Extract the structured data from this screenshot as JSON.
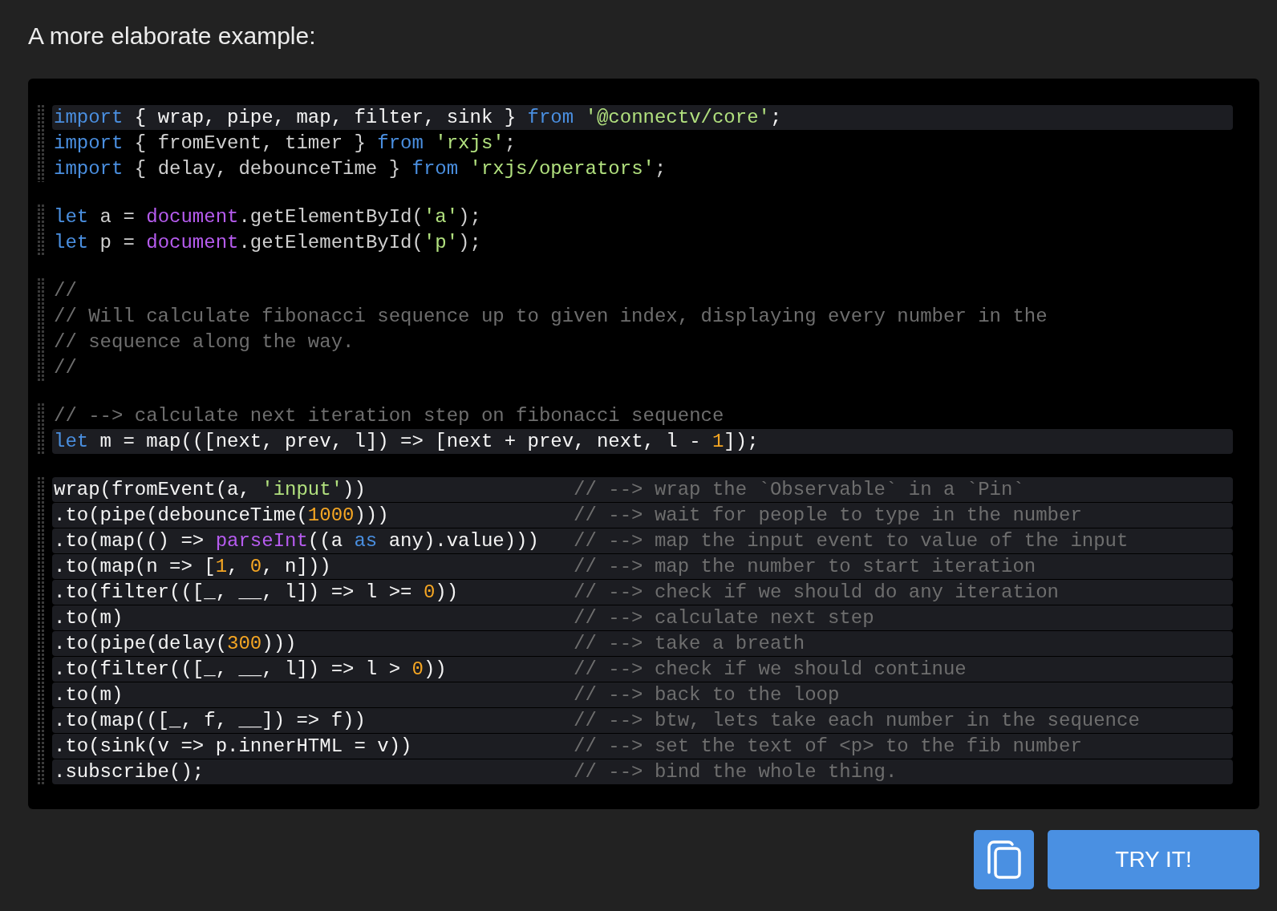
{
  "heading": "A more elaborate example:",
  "code_block": {
    "groups": [
      {
        "lines": [
          {
            "highlighted": true,
            "tokens": [
              {
                "kind": "keyword",
                "text": "import"
              },
              {
                "kind": "plain",
                "text": " { wrap, pipe, map, filter, sink } "
              },
              {
                "kind": "keyword",
                "text": "from"
              },
              {
                "kind": "string",
                "text": " '@connectv/core'"
              },
              {
                "kind": "plain",
                "text": ";"
              }
            ]
          },
          {
            "highlighted": false,
            "tokens": [
              {
                "kind": "keyword",
                "text": "import"
              },
              {
                "kind": "plain",
                "text": " { fromEvent, timer } "
              },
              {
                "kind": "keyword",
                "text": "from"
              },
              {
                "kind": "string",
                "text": " 'rxjs'"
              },
              {
                "kind": "plain",
                "text": ";"
              }
            ]
          },
          {
            "highlighted": false,
            "tokens": [
              {
                "kind": "keyword",
                "text": "import"
              },
              {
                "kind": "plain",
                "text": " { delay, debounceTime } "
              },
              {
                "kind": "keyword",
                "text": "from"
              },
              {
                "kind": "string",
                "text": " 'rxjs/operators'"
              },
              {
                "kind": "plain",
                "text": ";"
              }
            ]
          }
        ]
      },
      {
        "lines": [
          {
            "highlighted": false,
            "tokens": [
              {
                "kind": "keyword",
                "text": "let"
              },
              {
                "kind": "plain",
                "text": " a = "
              },
              {
                "kind": "builtin",
                "text": "document"
              },
              {
                "kind": "plain",
                "text": ".getElementById("
              },
              {
                "kind": "string",
                "text": "'a'"
              },
              {
                "kind": "plain",
                "text": ");"
              }
            ]
          },
          {
            "highlighted": false,
            "tokens": [
              {
                "kind": "keyword",
                "text": "let"
              },
              {
                "kind": "plain",
                "text": " p = "
              },
              {
                "kind": "builtin",
                "text": "document"
              },
              {
                "kind": "plain",
                "text": ".getElementById("
              },
              {
                "kind": "string",
                "text": "'p'"
              },
              {
                "kind": "plain",
                "text": ");"
              }
            ]
          }
        ]
      },
      {
        "lines": [
          {
            "highlighted": false,
            "tokens": [
              {
                "kind": "comment",
                "text": "//"
              }
            ]
          },
          {
            "highlighted": false,
            "tokens": [
              {
                "kind": "comment",
                "text": "// Will calculate fibonacci sequence up to given index, displaying every number in the"
              }
            ]
          },
          {
            "highlighted": false,
            "tokens": [
              {
                "kind": "comment",
                "text": "// sequence along the way."
              }
            ]
          },
          {
            "highlighted": false,
            "tokens": [
              {
                "kind": "comment",
                "text": "//"
              }
            ]
          }
        ]
      },
      {
        "lines": [
          {
            "highlighted": false,
            "tokens": [
              {
                "kind": "comment",
                "text": "// --> calculate next iteration step on fibonacci sequence"
              }
            ]
          },
          {
            "highlighted": true,
            "tokens": [
              {
                "kind": "keyword",
                "text": "let"
              },
              {
                "kind": "plain",
                "text": " m = map(([next, prev, l]) => [next + prev, next, l - "
              },
              {
                "kind": "number",
                "text": "1"
              },
              {
                "kind": "plain",
                "text": "]);"
              }
            ]
          }
        ]
      },
      {
        "lines": [
          {
            "highlighted": true,
            "tokens": [
              {
                "kind": "plain",
                "text": "wrap(fromEvent(a, "
              },
              {
                "kind": "string",
                "text": "'input'"
              },
              {
                "kind": "plain",
                "text": "))"
              }
            ],
            "comment": "// --> wrap the `Observable` in a `Pin`"
          },
          {
            "highlighted": true,
            "tokens": [
              {
                "kind": "plain",
                "text": ".to(pipe(debounceTime("
              },
              {
                "kind": "number",
                "text": "1000"
              },
              {
                "kind": "plain",
                "text": ")))"
              }
            ],
            "comment": "// --> wait for people to type in the number"
          },
          {
            "highlighted": true,
            "tokens": [
              {
                "kind": "plain",
                "text": ".to(map(() => "
              },
              {
                "kind": "builtin",
                "text": "parseInt"
              },
              {
                "kind": "plain",
                "text": "((a "
              },
              {
                "kind": "keyword",
                "text": "as"
              },
              {
                "kind": "plain",
                "text": " any).value)))"
              }
            ],
            "comment": "// --> map the input event to value of the input"
          },
          {
            "highlighted": true,
            "tokens": [
              {
                "kind": "plain",
                "text": ".to(map(n => ["
              },
              {
                "kind": "number",
                "text": "1"
              },
              {
                "kind": "plain",
                "text": ", "
              },
              {
                "kind": "number",
                "text": "0"
              },
              {
                "kind": "plain",
                "text": ", n]))"
              }
            ],
            "comment": "// --> map the number to start iteration"
          },
          {
            "highlighted": true,
            "tokens": [
              {
                "kind": "plain",
                "text": ".to(filter(([_, __, l]) => l >= "
              },
              {
                "kind": "number",
                "text": "0"
              },
              {
                "kind": "plain",
                "text": "))"
              }
            ],
            "comment": "// --> check if we should do any iteration"
          },
          {
            "highlighted": true,
            "tokens": [
              {
                "kind": "plain",
                "text": ".to(m)"
              }
            ],
            "comment": "// --> calculate next step"
          },
          {
            "highlighted": true,
            "tokens": [
              {
                "kind": "plain",
                "text": ".to(pipe(delay("
              },
              {
                "kind": "number",
                "text": "300"
              },
              {
                "kind": "plain",
                "text": ")))"
              }
            ],
            "comment": "// --> take a breath"
          },
          {
            "highlighted": true,
            "tokens": [
              {
                "kind": "plain",
                "text": ".to(filter(([_, __, l]) => l > "
              },
              {
                "kind": "number",
                "text": "0"
              },
              {
                "kind": "plain",
                "text": "))"
              }
            ],
            "comment": "// --> check if we should continue"
          },
          {
            "highlighted": true,
            "tokens": [
              {
                "kind": "plain",
                "text": ".to(m)"
              }
            ],
            "comment": "// --> back to the loop"
          },
          {
            "highlighted": true,
            "tokens": [
              {
                "kind": "plain",
                "text": ".to(map(([_, f, __]) => f))"
              }
            ],
            "comment": "// --> btw, lets take each number in the sequence"
          },
          {
            "highlighted": true,
            "tokens": [
              {
                "kind": "plain",
                "text": ".to(sink(v => p.innerHTML = v))"
              }
            ],
            "comment": "// --> set the text of <p> to the fib number"
          },
          {
            "highlighted": true,
            "tokens": [
              {
                "kind": "plain",
                "text": ".subscribe();"
              }
            ],
            "comment": "// --> bind the whole thing."
          }
        ]
      }
    ]
  },
  "buttons": [
    {
      "kind": "icon"
    },
    {
      "kind": "text",
      "label": "TRY IT!"
    }
  ]
}
